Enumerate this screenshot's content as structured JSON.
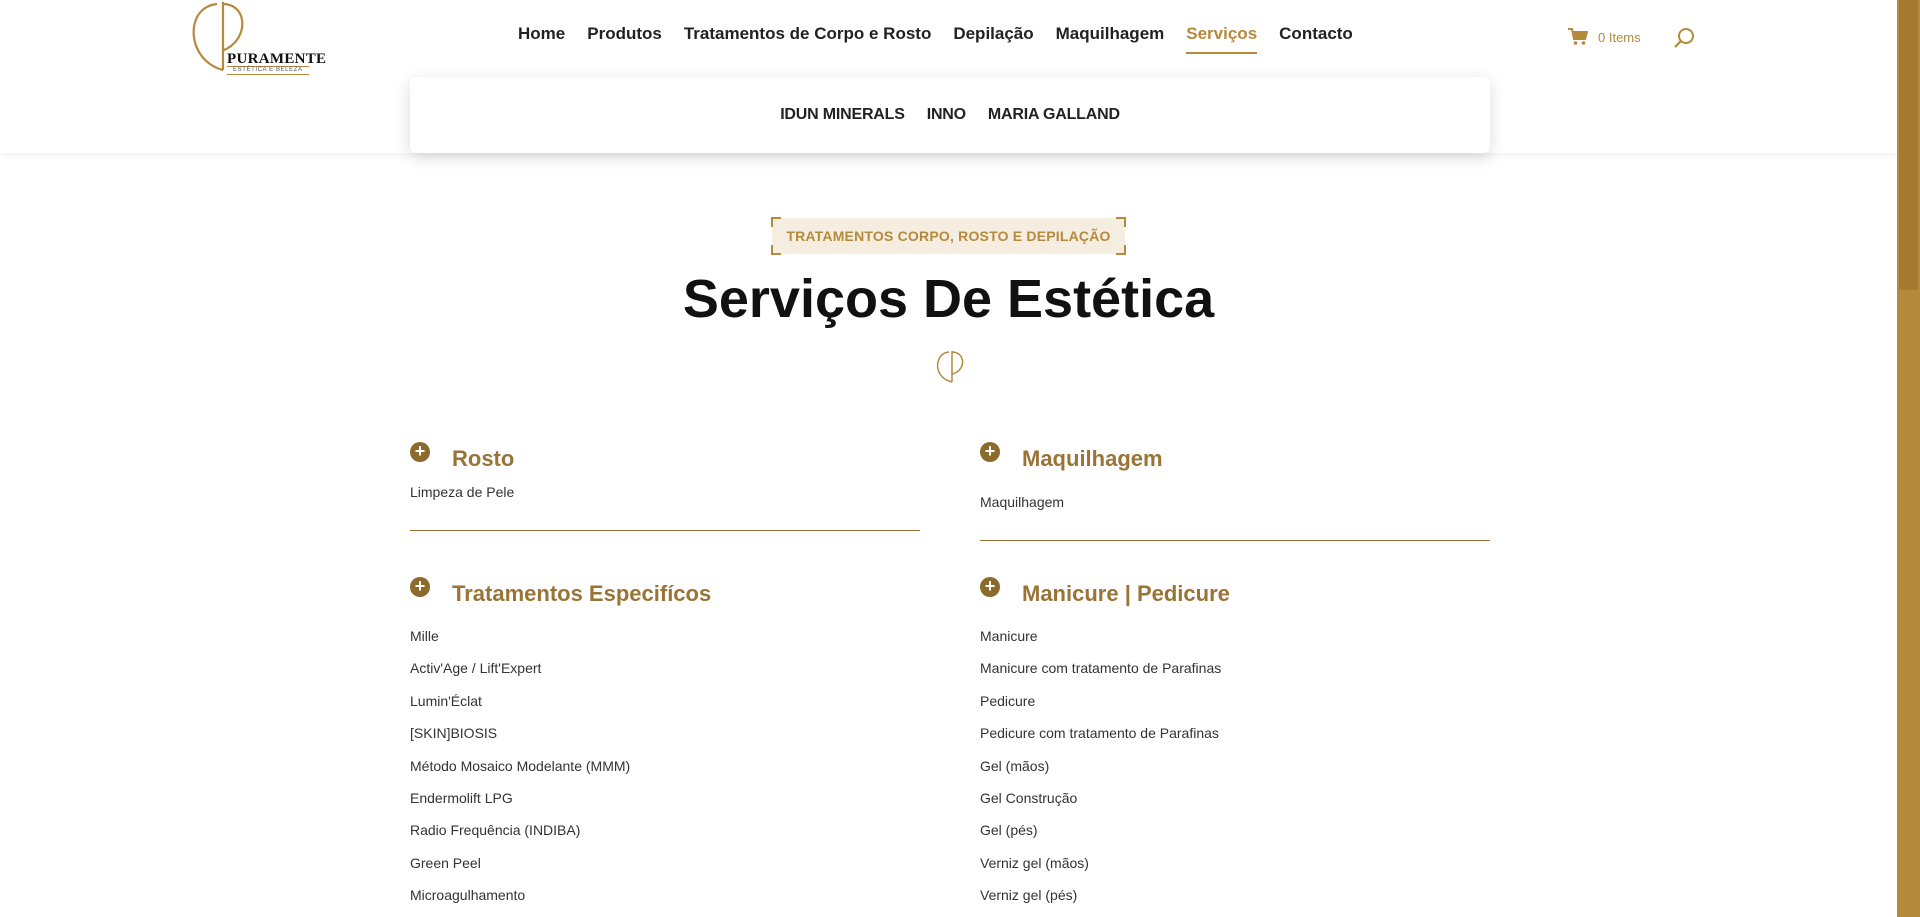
{
  "logo": {
    "name": "PURAMENTE",
    "tagline": "ESTÉTICA E BELEZA"
  },
  "nav": {
    "items": [
      "Home",
      "Produtos",
      "Tratamentos de Corpo e Rosto",
      "Depilação",
      "Maquilhagem",
      "Serviços",
      "Contacto"
    ],
    "active": "Serviços"
  },
  "cart": {
    "label": "0 Items"
  },
  "dropdown": {
    "items": [
      "IDUN MINERALS",
      "INNO",
      "MARIA GALLAND"
    ]
  },
  "hero": {
    "eyebrow": "TRATAMENTOS CORPO, ROSTO E DEPILAÇÃO",
    "title": "Serviços De Estética"
  },
  "sections": {
    "rosto": {
      "title": "Rosto",
      "items": [
        "Limpeza de Pele"
      ]
    },
    "maquilhagem": {
      "title": "Maquilhagem",
      "items": [
        "Maquilhagem"
      ]
    },
    "especificos": {
      "title": "Tratamentos Especifícos",
      "items": [
        "Mille",
        "Activ'Age / Lift'Expert",
        "Lumin'Éclat",
        "[SKIN]BIOSIS",
        "Método Mosaico Modelante (MMM)",
        "Endermolift LPG",
        "Radio Frequência (INDIBA)",
        "Green Peel",
        "Microagulhamento"
      ]
    },
    "manicure": {
      "title": "Manicure | Pedicure",
      "items": [
        "Manicure",
        "Manicure com tratamento de Parafinas",
        "Pedicure",
        "Pedicure com tratamento de Parafinas",
        "Gel (mãos)",
        "Gel Construção",
        "Gel (pés)",
        "Verniz gel (mãos)",
        "Verniz gel (pés)"
      ]
    }
  },
  "colors": {
    "accent": "#b58a3d",
    "accent_dark": "#9a7436",
    "eyebrow_bg": "#f6ede1"
  },
  "icons": {
    "cart": "cart-icon",
    "search": "search-icon",
    "plus": "plus-circle-icon",
    "divider": "logo-mark-icon"
  }
}
